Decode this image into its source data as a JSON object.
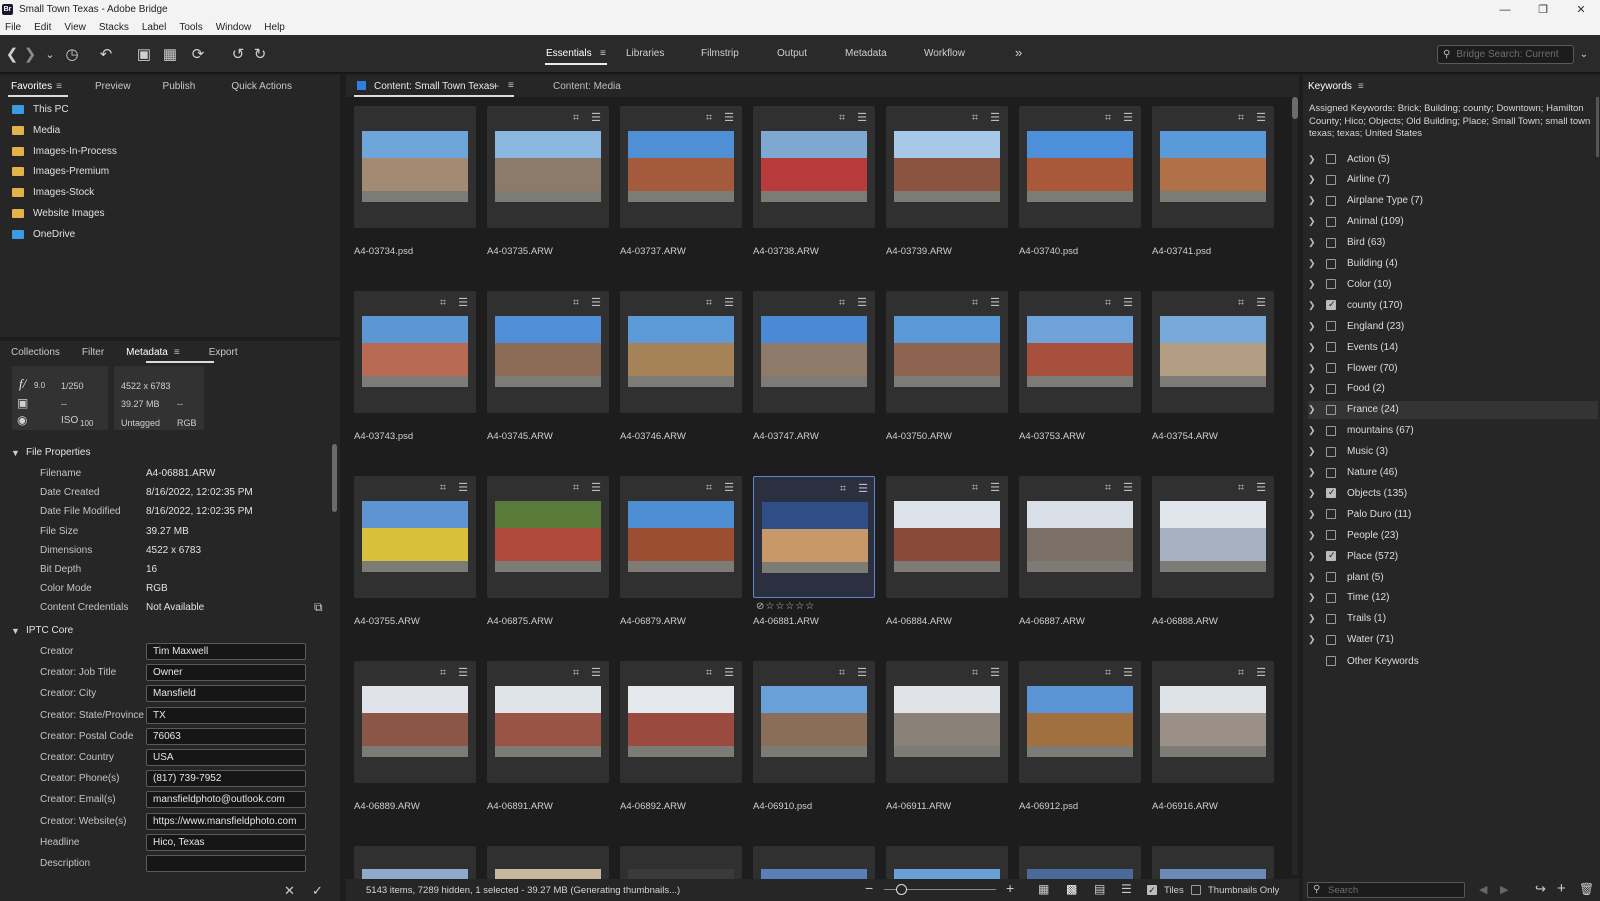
{
  "window": {
    "title": "Small Town Texas - Adobe Bridge",
    "app_icon": "Br"
  },
  "menu": [
    "File",
    "Edit",
    "View",
    "Stacks",
    "Label",
    "Tools",
    "Window",
    "Help"
  ],
  "workspaces": [
    "Essentials",
    "Libraries",
    "Filmstrip",
    "Output",
    "Metadata",
    "Workflow"
  ],
  "active_workspace": "Essentials",
  "more_workspaces": "»",
  "search": {
    "placeholder": "Bridge Search: Current"
  },
  "left_top_tabs": [
    "Favorites",
    "Preview",
    "Publish",
    "Quick Actions"
  ],
  "favorites": [
    {
      "label": "This PC",
      "icon": "pc-icon"
    },
    {
      "label": "Media",
      "icon": "folder-icon"
    },
    {
      "label": "Images-In-Process",
      "icon": "folder-icon"
    },
    {
      "label": "Images-Premium",
      "icon": "folder-icon"
    },
    {
      "label": "Images-Stock",
      "icon": "folder-icon"
    },
    {
      "label": "Website Images",
      "icon": "folder-icon"
    },
    {
      "label": "OneDrive",
      "icon": "cloud-folder-icon"
    }
  ],
  "left_mid_tabs": [
    "Collections",
    "Filter",
    "Metadata",
    "Export"
  ],
  "metadata_summary": {
    "aperture": "9.0",
    "shutter": "1/250",
    "exposure_a": "--",
    "exposure_b": "--",
    "iso_label": "ISO",
    "iso": "100",
    "dimensions": "4522 x 6783",
    "size": "39.27 MB",
    "size_extra": "--",
    "tagged": "Untagged",
    "mode": "RGB"
  },
  "file_properties": {
    "title": "File Properties",
    "rows": [
      {
        "label": "Filename",
        "value": "A4-06881.ARW"
      },
      {
        "label": "Date Created",
        "value": "8/16/2022, 12:02:35 PM"
      },
      {
        "label": "Date File Modified",
        "value": "8/16/2022, 12:02:35 PM"
      },
      {
        "label": "File Size",
        "value": "39.27 MB"
      },
      {
        "label": "Dimensions",
        "value": "4522 x 6783"
      },
      {
        "label": "Bit Depth",
        "value": "16"
      },
      {
        "label": "Color Mode",
        "value": "RGB"
      },
      {
        "label": "Content Credentials",
        "value": "Not Available"
      }
    ]
  },
  "iptc": {
    "title": "IPTC Core",
    "rows": [
      {
        "label": "Creator",
        "value": "Tim Maxwell"
      },
      {
        "label": "Creator: Job Title",
        "value": "Owner"
      },
      {
        "label": "Creator: City",
        "value": "Mansfield"
      },
      {
        "label": "Creator: State/Province",
        "value": "TX"
      },
      {
        "label": "Creator: Postal Code",
        "value": "76063"
      },
      {
        "label": "Creator: Country",
        "value": "USA"
      },
      {
        "label": "Creator: Phone(s)",
        "value": "(817) 739-7952"
      },
      {
        "label": "Creator: Email(s)",
        "value": "mansfieldphoto@outlook.com"
      },
      {
        "label": "Creator: Website(s)",
        "value": "https://www.mansfieldphoto.com"
      },
      {
        "label": "Headline",
        "value": "Hico, Texas"
      },
      {
        "label": "Description",
        "value": ""
      }
    ]
  },
  "content_tabs": [
    "Content: Small Town Texas",
    "Content: Media"
  ],
  "thumbnails": [
    {
      "name": "A4-03734.psd",
      "sky": "#6fa5d8",
      "bld": "#a38a72"
    },
    {
      "name": "A4-03735.ARW",
      "sky": "#8bb6de",
      "bld": "#8b7b68"
    },
    {
      "name": "A4-03737.ARW",
      "sky": "#4f8fd4",
      "bld": "#a45a3c"
    },
    {
      "name": "A4-03738.ARW",
      "sky": "#7fa8d0",
      "bld": "#b83a3a"
    },
    {
      "name": "A4-03739.ARW",
      "sky": "#a8c8e8",
      "bld": "#8a5440"
    },
    {
      "name": "A4-03740.psd",
      "sky": "#4d8fd8",
      "bld": "#a9583a"
    },
    {
      "name": "A4-03741.psd",
      "sky": "#5a9ad8",
      "bld": "#b07048"
    },
    {
      "name": "A4-03743.psd",
      "sky": "#5c97d4",
      "bld": "#b86a55"
    },
    {
      "name": "A4-03745.ARW",
      "sky": "#4e8fd8",
      "bld": "#8b6b55"
    },
    {
      "name": "A4-03746.ARW",
      "sky": "#5d9ad8",
      "bld": "#a68258"
    },
    {
      "name": "A4-03747.ARW",
      "sky": "#4a8ad4",
      "bld": "#8d7a68"
    },
    {
      "name": "A4-03750.ARW",
      "sky": "#5b98d8",
      "bld": "#8d6450"
    },
    {
      "name": "A4-03753.ARW",
      "sky": "#6ea2d8",
      "bld": "#a8503e"
    },
    {
      "name": "A4-03754.ARW",
      "sky": "#78a8d8",
      "bld": "#b39e84"
    },
    {
      "name": "A4-03755.ARW",
      "sky": "#5e94d2",
      "bld": "#d9c03a"
    },
    {
      "name": "A4-06875.ARW",
      "sky": "#5a7a3a",
      "bld": "#b04a3a"
    },
    {
      "name": "A4-06879.ARW",
      "sky": "#4e8fd4",
      "bld": "#9c4e32"
    },
    {
      "name": "A4-06881.ARW",
      "sky": "#2f4d86",
      "bld": "#c89868"
    },
    {
      "name": "A4-06884.ARW",
      "sky": "#dbe2ea",
      "bld": "#8a4a3a"
    },
    {
      "name": "A4-06887.ARW",
      "sky": "#d8dfe7",
      "bld": "#7a7066"
    },
    {
      "name": "A4-06888.ARW",
      "sky": "#e0e6ec",
      "bld": "#a6b2c0"
    },
    {
      "name": "A4-06889.ARW",
      "sky": "#e0e4ea",
      "bld": "#8a5646"
    },
    {
      "name": "A4-06891.ARW",
      "sky": "#dfe4ea",
      "bld": "#9a5446"
    },
    {
      "name": "A4-06892.ARW",
      "sky": "#e4e8ec",
      "bld": "#9a4a3e"
    },
    {
      "name": "A4-06910.psd",
      "sky": "#6aa0d8",
      "bld": "#8a6e58"
    },
    {
      "name": "A4-06911.ARW",
      "sky": "#e0e4e8",
      "bld": "#8a8278"
    },
    {
      "name": "A4-06912.psd",
      "sky": "#5a94d4",
      "bld": "#a0703e"
    },
    {
      "name": "A4-06916.ARW",
      "sky": "#dee3e8",
      "bld": "#9a9088"
    }
  ],
  "selected_index": 17,
  "status": "5143 items, 7289 hidden, 1 selected - 39.27 MB (Generating thumbnails...)",
  "view_options": {
    "tiles": "Tiles",
    "thumbnails_only": "Thumbnails Only"
  },
  "keywords": {
    "title": "Keywords",
    "assigned": "Assigned Keywords: Brick; Building; county; Downtown; Hamilton County; Hico; Objects; Old Building; Place; Small Town; small town texas; texas; United States",
    "items": [
      {
        "label": "Action  (5)",
        "checked": false
      },
      {
        "label": "Airline  (7)",
        "checked": false
      },
      {
        "label": "Airplane Type  (7)",
        "checked": false
      },
      {
        "label": "Animal  (109)",
        "checked": false
      },
      {
        "label": "Bird  (63)",
        "checked": false
      },
      {
        "label": "Building  (4)",
        "checked": false
      },
      {
        "label": "Color  (10)",
        "checked": false
      },
      {
        "label": "county  (170)",
        "checked": true
      },
      {
        "label": "England  (23)",
        "checked": false
      },
      {
        "label": "Events  (14)",
        "checked": false
      },
      {
        "label": "Flower  (70)",
        "checked": false
      },
      {
        "label": "Food  (2)",
        "checked": false
      },
      {
        "label": "France  (24)",
        "checked": false
      },
      {
        "label": "mountains  (67)",
        "checked": false
      },
      {
        "label": "Music  (3)",
        "checked": false
      },
      {
        "label": "Nature  (46)",
        "checked": false
      },
      {
        "label": "Objects  (135)",
        "checked": true
      },
      {
        "label": "Palo Duro  (11)",
        "checked": false
      },
      {
        "label": "People  (23)",
        "checked": false
      },
      {
        "label": "Place  (572)",
        "checked": true
      },
      {
        "label": "plant  (5)",
        "checked": false
      },
      {
        "label": "Time  (12)",
        "checked": false
      },
      {
        "label": "Trails  (1)",
        "checked": false
      },
      {
        "label": "Water  (71)",
        "checked": false
      }
    ],
    "other": "Other Keywords",
    "search_placeholder": "Search"
  }
}
